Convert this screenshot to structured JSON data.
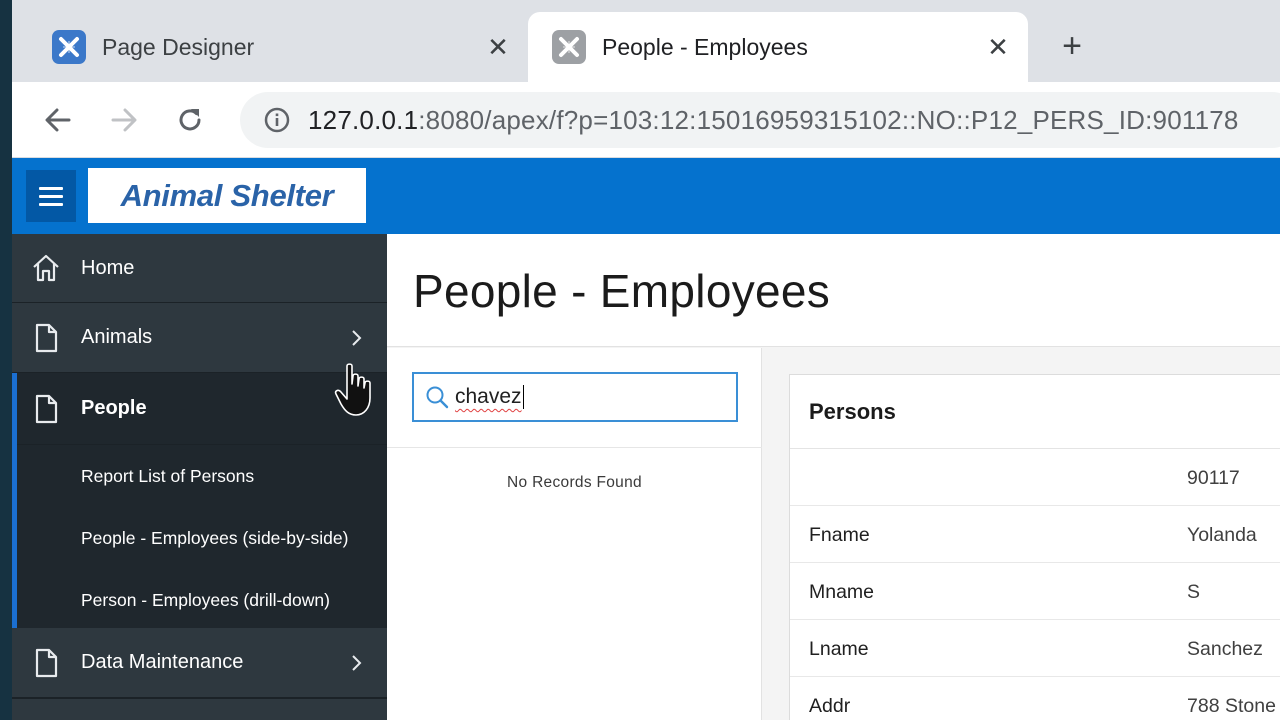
{
  "browser": {
    "tabs": [
      {
        "title": "Page Designer",
        "active": false,
        "favicon": "apex-icon"
      },
      {
        "title": "People - Employees",
        "active": true,
        "favicon": "apex-icon"
      }
    ],
    "close_glyph": "✕",
    "new_tab_glyph": "+",
    "url": {
      "host": "127.0.0.1",
      "rest": ":8080/apex/f?p=103:12:15016959315102::NO::P12_PERS_ID:901178"
    }
  },
  "app": {
    "name": "Animal Shelter",
    "colors": {
      "header": "#0572ce",
      "sidebar": "#262f36",
      "accent": "#1b6fd1"
    }
  },
  "sidebar": {
    "items": [
      {
        "label": "Home",
        "icon": "home-icon",
        "has_children": false
      },
      {
        "label": "Animals",
        "icon": "page-icon",
        "has_children": true
      },
      {
        "label": "People",
        "icon": "page-icon",
        "has_children": false,
        "expanded": true,
        "children": [
          {
            "label": "Report List of Persons"
          },
          {
            "label": "People - Employees (side-by-side)"
          },
          {
            "label": "Person - Employees (drill-down)"
          }
        ]
      },
      {
        "label": "Data Maintenance",
        "icon": "page-icon",
        "has_children": true
      }
    ]
  },
  "main": {
    "page_title": "People - Employees",
    "search": {
      "value": "chavez",
      "icon": "search-icon"
    },
    "no_records": "No Records Found",
    "persons_card": {
      "title": "Persons",
      "rows": [
        {
          "label": "",
          "value": "90117"
        },
        {
          "label": "Fname",
          "value": "Yolanda"
        },
        {
          "label": "Mname",
          "value": "S"
        },
        {
          "label": "Lname",
          "value": "Sanchez"
        },
        {
          "label": "Addr",
          "value": "788 Stone"
        }
      ]
    }
  }
}
